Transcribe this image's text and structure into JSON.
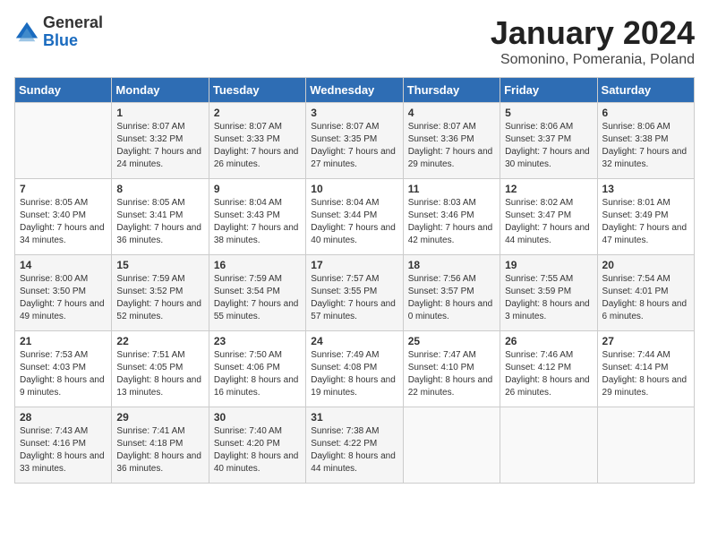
{
  "logo": {
    "general": "General",
    "blue": "Blue"
  },
  "header": {
    "title": "January 2024",
    "subtitle": "Somonino, Pomerania, Poland"
  },
  "days_of_week": [
    "Sunday",
    "Monday",
    "Tuesday",
    "Wednesday",
    "Thursday",
    "Friday",
    "Saturday"
  ],
  "weeks": [
    [
      {
        "day": "",
        "sunrise": "",
        "sunset": "",
        "daylight": ""
      },
      {
        "day": "1",
        "sunrise": "8:07 AM",
        "sunset": "3:32 PM",
        "daylight": "7 hours and 24 minutes."
      },
      {
        "day": "2",
        "sunrise": "8:07 AM",
        "sunset": "3:33 PM",
        "daylight": "7 hours and 26 minutes."
      },
      {
        "day": "3",
        "sunrise": "8:07 AM",
        "sunset": "3:35 PM",
        "daylight": "7 hours and 27 minutes."
      },
      {
        "day": "4",
        "sunrise": "8:07 AM",
        "sunset": "3:36 PM",
        "daylight": "7 hours and 29 minutes."
      },
      {
        "day": "5",
        "sunrise": "8:06 AM",
        "sunset": "3:37 PM",
        "daylight": "7 hours and 30 minutes."
      },
      {
        "day": "6",
        "sunrise": "8:06 AM",
        "sunset": "3:38 PM",
        "daylight": "7 hours and 32 minutes."
      }
    ],
    [
      {
        "day": "7",
        "sunrise": "8:05 AM",
        "sunset": "3:40 PM",
        "daylight": "7 hours and 34 minutes."
      },
      {
        "day": "8",
        "sunrise": "8:05 AM",
        "sunset": "3:41 PM",
        "daylight": "7 hours and 36 minutes."
      },
      {
        "day": "9",
        "sunrise": "8:04 AM",
        "sunset": "3:43 PM",
        "daylight": "7 hours and 38 minutes."
      },
      {
        "day": "10",
        "sunrise": "8:04 AM",
        "sunset": "3:44 PM",
        "daylight": "7 hours and 40 minutes."
      },
      {
        "day": "11",
        "sunrise": "8:03 AM",
        "sunset": "3:46 PM",
        "daylight": "7 hours and 42 minutes."
      },
      {
        "day": "12",
        "sunrise": "8:02 AM",
        "sunset": "3:47 PM",
        "daylight": "7 hours and 44 minutes."
      },
      {
        "day": "13",
        "sunrise": "8:01 AM",
        "sunset": "3:49 PM",
        "daylight": "7 hours and 47 minutes."
      }
    ],
    [
      {
        "day": "14",
        "sunrise": "8:00 AM",
        "sunset": "3:50 PM",
        "daylight": "7 hours and 49 minutes."
      },
      {
        "day": "15",
        "sunrise": "7:59 AM",
        "sunset": "3:52 PM",
        "daylight": "7 hours and 52 minutes."
      },
      {
        "day": "16",
        "sunrise": "7:59 AM",
        "sunset": "3:54 PM",
        "daylight": "7 hours and 55 minutes."
      },
      {
        "day": "17",
        "sunrise": "7:57 AM",
        "sunset": "3:55 PM",
        "daylight": "7 hours and 57 minutes."
      },
      {
        "day": "18",
        "sunrise": "7:56 AM",
        "sunset": "3:57 PM",
        "daylight": "8 hours and 0 minutes."
      },
      {
        "day": "19",
        "sunrise": "7:55 AM",
        "sunset": "3:59 PM",
        "daylight": "8 hours and 3 minutes."
      },
      {
        "day": "20",
        "sunrise": "7:54 AM",
        "sunset": "4:01 PM",
        "daylight": "8 hours and 6 minutes."
      }
    ],
    [
      {
        "day": "21",
        "sunrise": "7:53 AM",
        "sunset": "4:03 PM",
        "daylight": "8 hours and 9 minutes."
      },
      {
        "day": "22",
        "sunrise": "7:51 AM",
        "sunset": "4:05 PM",
        "daylight": "8 hours and 13 minutes."
      },
      {
        "day": "23",
        "sunrise": "7:50 AM",
        "sunset": "4:06 PM",
        "daylight": "8 hours and 16 minutes."
      },
      {
        "day": "24",
        "sunrise": "7:49 AM",
        "sunset": "4:08 PM",
        "daylight": "8 hours and 19 minutes."
      },
      {
        "day": "25",
        "sunrise": "7:47 AM",
        "sunset": "4:10 PM",
        "daylight": "8 hours and 22 minutes."
      },
      {
        "day": "26",
        "sunrise": "7:46 AM",
        "sunset": "4:12 PM",
        "daylight": "8 hours and 26 minutes."
      },
      {
        "day": "27",
        "sunrise": "7:44 AM",
        "sunset": "4:14 PM",
        "daylight": "8 hours and 29 minutes."
      }
    ],
    [
      {
        "day": "28",
        "sunrise": "7:43 AM",
        "sunset": "4:16 PM",
        "daylight": "8 hours and 33 minutes."
      },
      {
        "day": "29",
        "sunrise": "7:41 AM",
        "sunset": "4:18 PM",
        "daylight": "8 hours and 36 minutes."
      },
      {
        "day": "30",
        "sunrise": "7:40 AM",
        "sunset": "4:20 PM",
        "daylight": "8 hours and 40 minutes."
      },
      {
        "day": "31",
        "sunrise": "7:38 AM",
        "sunset": "4:22 PM",
        "daylight": "8 hours and 44 minutes."
      },
      {
        "day": "",
        "sunrise": "",
        "sunset": "",
        "daylight": ""
      },
      {
        "day": "",
        "sunrise": "",
        "sunset": "",
        "daylight": ""
      },
      {
        "day": "",
        "sunrise": "",
        "sunset": "",
        "daylight": ""
      }
    ]
  ]
}
